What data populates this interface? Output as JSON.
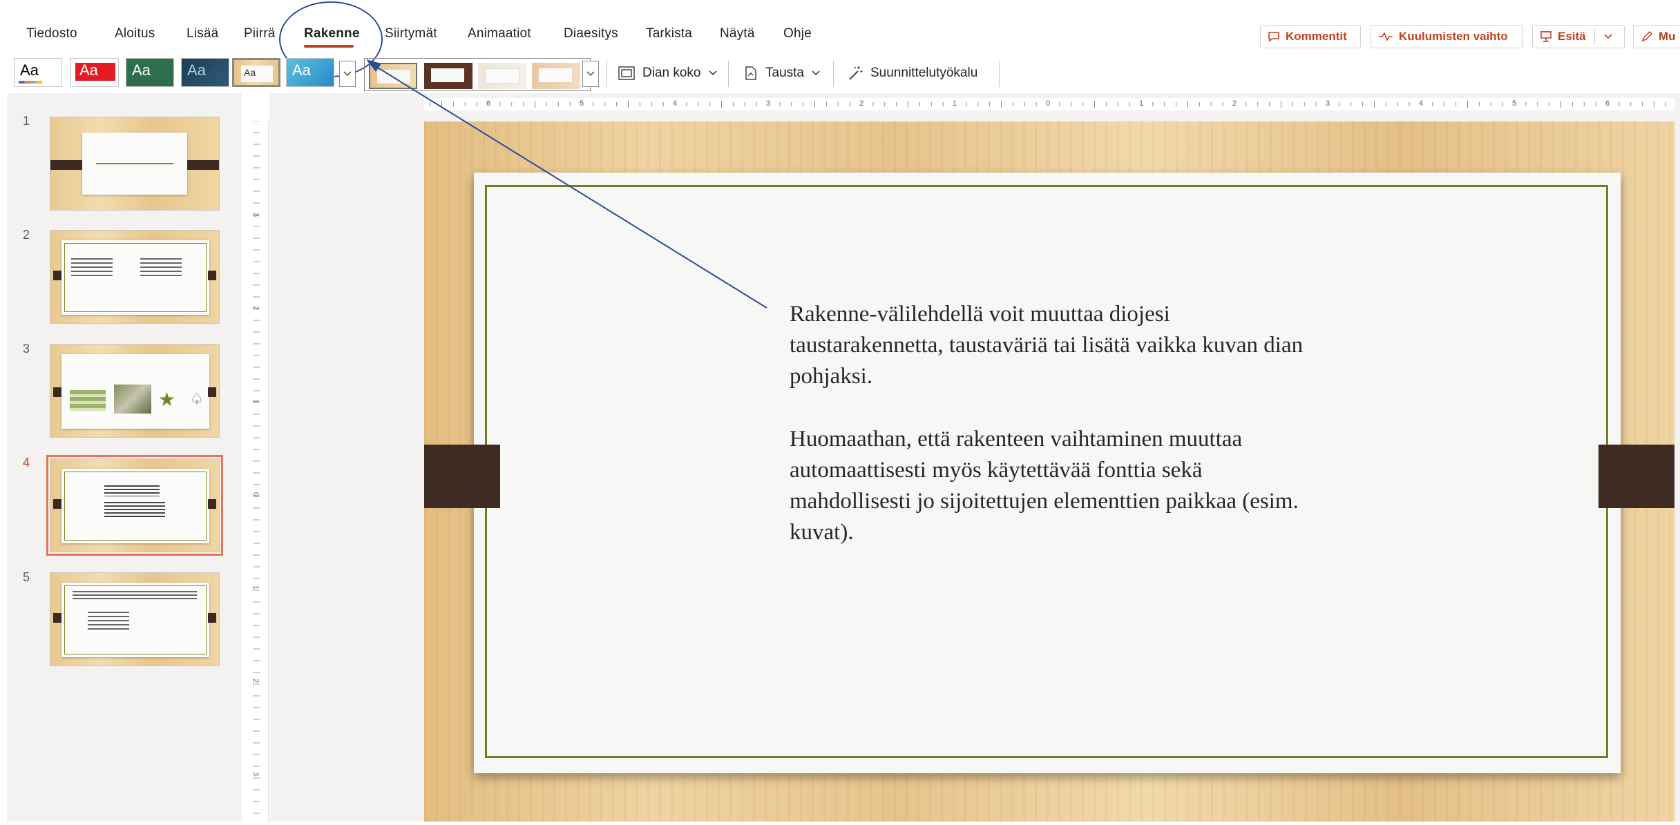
{
  "menu": {
    "items": [
      "Tiedosto",
      "Aloitus",
      "Lisää",
      "Piirrä",
      "Rakenne",
      "Siirtymät",
      "Animaatiot",
      "Diaesitys",
      "Tarkista",
      "Näytä",
      "Ohje"
    ],
    "active": "Rakenne"
  },
  "top_buttons": {
    "comments": "Kommentit",
    "catch_up": "Kuulumisten vaihto",
    "present": "Esitä",
    "edit": "Mu"
  },
  "ribbon": {
    "theme_label": "Aa",
    "slide_size": "Dian koko",
    "background": "Tausta",
    "designer": "Suunnittelutyökalu"
  },
  "slides": {
    "numbers": [
      "1",
      "2",
      "3",
      "4",
      "5"
    ],
    "active_index": 4
  },
  "ruler": {
    "h_ticks": [
      "6",
      "5",
      "4",
      "3",
      "2",
      "1",
      "0",
      "1",
      "2",
      "3",
      "4",
      "5",
      "6"
    ],
    "v_ticks": [
      "3",
      "2",
      "1",
      "0",
      "1",
      "2",
      "3"
    ]
  },
  "slide_text": {
    "paragraph_1": "Rakenne-välilehdellä voit muuttaa diojesi taustarakennetta, taustaväriä tai lisätä vaikka kuvan dian pohjaksi.",
    "paragraph_2": "Huomaathan, että rakenteen vaihtaminen muuttaa automaattisesti myös käytettävää fonttia sekä mahdollisesti jo sijoitettujen elementtien paikkaa (esim. kuvat)."
  },
  "colors": {
    "accent": "#c43e1c",
    "annotation": "#2b4c9b",
    "frame_green": "#6f7f22"
  }
}
